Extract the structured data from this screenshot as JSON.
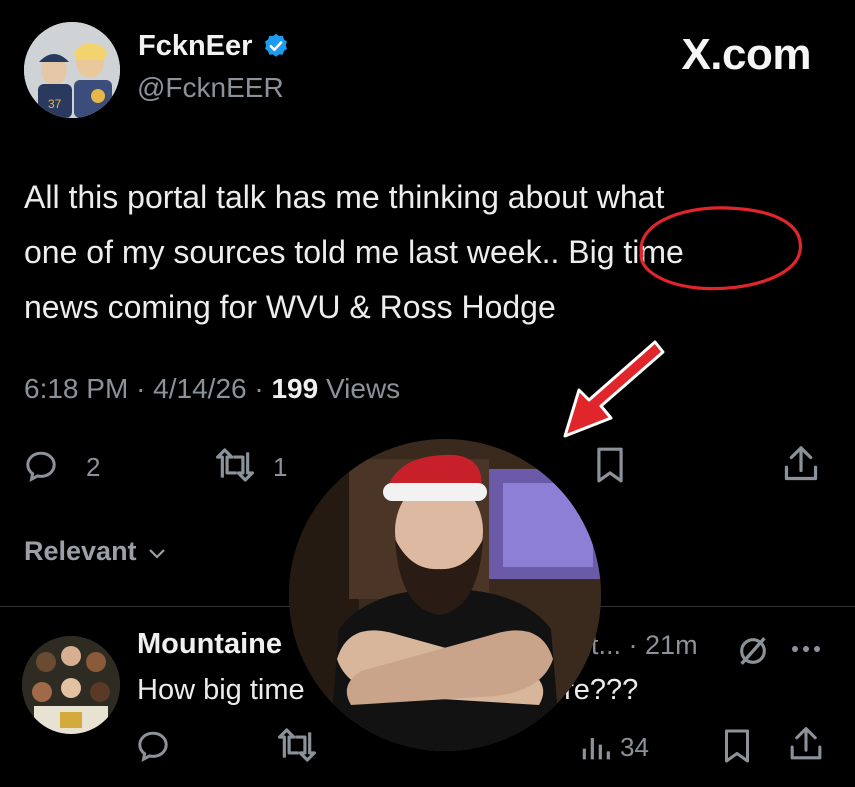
{
  "author": {
    "display_name": "FcknEer",
    "handle": "@FcknEER",
    "verified": true
  },
  "brand": "X.com",
  "tweet": {
    "lines": [
      "All this portal talk has me thinking about what",
      "one of my sources told me last week.. Big time",
      "news coming for WVU & Ross Hodge"
    ],
    "time": "6:18 PM",
    "date": "4/14/26",
    "views_count": "199",
    "views_label": "Views"
  },
  "actions": {
    "replies": "2",
    "reposts": "1"
  },
  "sort_label": "Relevant",
  "reply": {
    "name_visible": "Mountaine",
    "handle_visible": "it...",
    "time": "21m",
    "text_visible": "How big time",
    "text_tail_visible": "ere???",
    "views": "34"
  },
  "colors": {
    "background": "#000000",
    "verified_badge": "#1d9bf0",
    "annotation_red": "#e0262b",
    "muted_text": "#8b9299"
  },
  "icons": [
    "verified-badge-icon",
    "reply-icon",
    "repost-icon",
    "bookmark-icon",
    "share-icon",
    "chevron-down-icon",
    "views-icon",
    "grok-icon",
    "more-icon"
  ]
}
